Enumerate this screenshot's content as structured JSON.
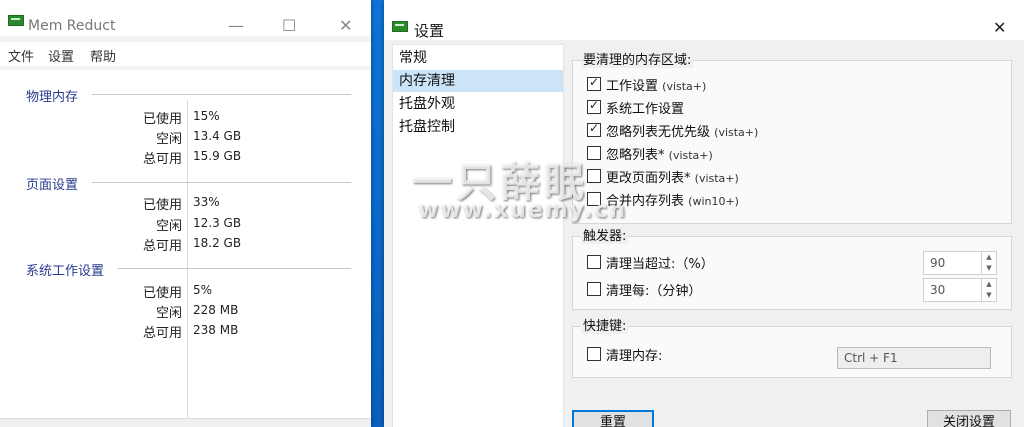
{
  "mem_window": {
    "title": "Mem Reduct",
    "menu": [
      "文件",
      "设置",
      "帮助"
    ],
    "groups": [
      {
        "title": "物理内存",
        "rows": [
          {
            "k": "已使用",
            "v": "15%"
          },
          {
            "k": "空闲",
            "v": "13.4 GB"
          },
          {
            "k": "总可用",
            "v": "15.9 GB"
          }
        ]
      },
      {
        "title": "页面设置",
        "rows": [
          {
            "k": "已使用",
            "v": "33%"
          },
          {
            "k": "空闲",
            "v": "12.3 GB"
          },
          {
            "k": "总可用",
            "v": "18.2 GB"
          }
        ]
      },
      {
        "title": "系统工作设置",
        "rows": [
          {
            "k": "已使用",
            "v": "5%"
          },
          {
            "k": "空闲",
            "v": "228 MB"
          },
          {
            "k": "总可用",
            "v": "238 MB"
          }
        ]
      }
    ]
  },
  "settings_window": {
    "title": "设置",
    "nav": [
      "常规",
      "内存清理",
      "托盘外观",
      "托盘控制"
    ],
    "selected_nav": "内存清理",
    "areas_panel": {
      "title": "要清理的内存区域:",
      "items": [
        {
          "label": "工作设置",
          "suffix": "(vista+)",
          "checked": true
        },
        {
          "label": "系统工作设置",
          "suffix": "",
          "checked": true
        },
        {
          "label": "忽略列表无优先级",
          "suffix": "(vista+)",
          "checked": true
        },
        {
          "label": "忽略列表*",
          "suffix": "(vista+)",
          "checked": false
        },
        {
          "label": "更改页面列表*",
          "suffix": "(vista+)",
          "checked": false
        },
        {
          "label": "合并内存列表",
          "suffix": "(win10+)",
          "checked": false
        }
      ]
    },
    "trigger_panel": {
      "title": "触发器:",
      "items": [
        {
          "label": "清理当超过:（%）",
          "checked": false,
          "value": "90"
        },
        {
          "label": "清理每:（分钟）",
          "checked": false,
          "value": "30"
        }
      ]
    },
    "hotkey_panel": {
      "title": "快捷键:",
      "label": "清理内存:",
      "checked": false,
      "value": "Ctrl + F1"
    },
    "buttons": {
      "reset": "重置",
      "close": "关闭设置"
    }
  },
  "watermark": {
    "line1": "一只薛眠",
    "line2": "www.xuemy.cn"
  }
}
